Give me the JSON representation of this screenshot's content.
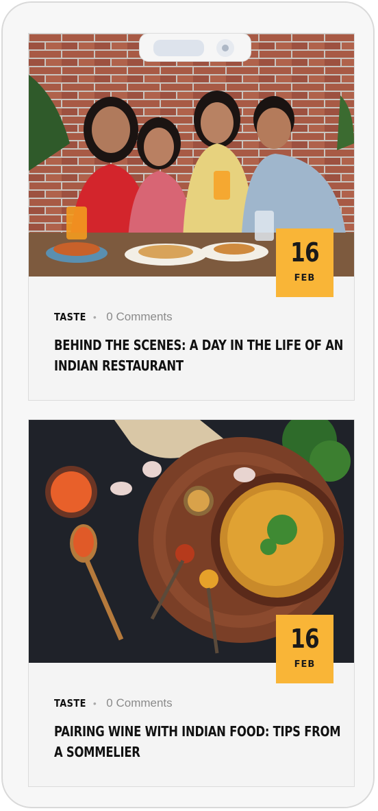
{
  "posts": [
    {
      "image_alt": "Family dining at an Indian restaurant",
      "date_day": "16",
      "date_month": "FEB",
      "category": "TASTE",
      "comments": "0 Comments",
      "title": "BEHIND THE SCENES: A DAY IN THE LIFE OF AN INDIAN RESTAURANT"
    },
    {
      "image_alt": "Indian lentil dal with spices",
      "date_day": "16",
      "date_month": "FEB",
      "category": "TASTE",
      "comments": "0 Comments",
      "title": "PAIRING WINE WITH INDIAN FOOD: TIPS FROM A SOMMELIER"
    }
  ],
  "colors": {
    "accent": "#f9b537",
    "text": "#111111",
    "muted": "#8a8a8a"
  }
}
